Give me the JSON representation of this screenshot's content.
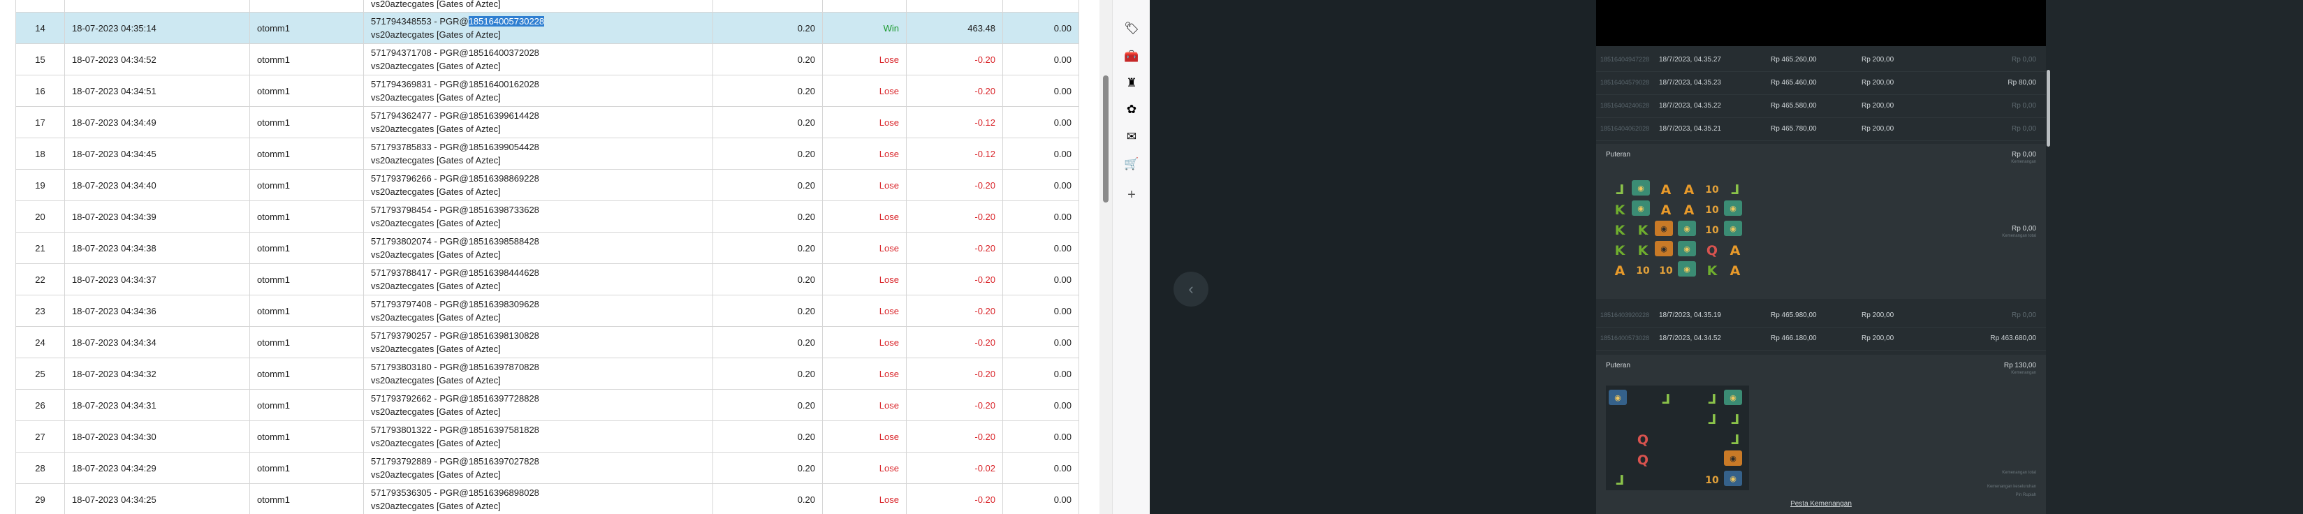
{
  "table": {
    "partial_row": {
      "desc": "vs20aztecgates [Gates of Aztec]"
    },
    "selected_highlight": "185164005730228",
    "rows": [
      {
        "no": "14",
        "date": "18-07-2023 04:35:14",
        "user": "otomm1",
        "desc_id": "571794348553 - PGR@",
        "desc_ref": "185164005730228",
        "desc_game": "vs20aztecgates [Gates of Aztec]",
        "bet": "0.20",
        "result": "Win",
        "winloss": "463.48",
        "extra": "0.00",
        "selected": true
      },
      {
        "no": "15",
        "date": "18-07-2023 04:34:52",
        "user": "otomm1",
        "desc_id": "571794371708 - PGR@",
        "desc_ref": "18516400372028",
        "desc_game": "vs20aztecgates [Gates of Aztec]",
        "bet": "0.20",
        "result": "Lose",
        "winloss": "-0.20",
        "extra": "0.00"
      },
      {
        "no": "16",
        "date": "18-07-2023 04:34:51",
        "user": "otomm1",
        "desc_id": "571794369831 - PGR@",
        "desc_ref": "18516400162028",
        "desc_game": "vs20aztecgates [Gates of Aztec]",
        "bet": "0.20",
        "result": "Lose",
        "winloss": "-0.20",
        "extra": "0.00"
      },
      {
        "no": "17",
        "date": "18-07-2023 04:34:49",
        "user": "otomm1",
        "desc_id": "571794362477 - PGR@",
        "desc_ref": "18516399614428",
        "desc_game": "vs20aztecgates [Gates of Aztec]",
        "bet": "0.20",
        "result": "Lose",
        "winloss": "-0.12",
        "extra": "0.00"
      },
      {
        "no": "18",
        "date": "18-07-2023 04:34:45",
        "user": "otomm1",
        "desc_id": "571793785833 - PGR@",
        "desc_ref": "18516399054428",
        "desc_game": "vs20aztecgates [Gates of Aztec]",
        "bet": "0.20",
        "result": "Lose",
        "winloss": "-0.12",
        "extra": "0.00"
      },
      {
        "no": "19",
        "date": "18-07-2023 04:34:40",
        "user": "otomm1",
        "desc_id": "571793796266 - PGR@",
        "desc_ref": "18516398869228",
        "desc_game": "vs20aztecgates [Gates of Aztec]",
        "bet": "0.20",
        "result": "Lose",
        "winloss": "-0.20",
        "extra": "0.00"
      },
      {
        "no": "20",
        "date": "18-07-2023 04:34:39",
        "user": "otomm1",
        "desc_id": "571793798454 - PGR@",
        "desc_ref": "18516398733628",
        "desc_game": "vs20aztecgates [Gates of Aztec]",
        "bet": "0.20",
        "result": "Lose",
        "winloss": "-0.20",
        "extra": "0.00"
      },
      {
        "no": "21",
        "date": "18-07-2023 04:34:38",
        "user": "otomm1",
        "desc_id": "571793802074 - PGR@",
        "desc_ref": "18516398588428",
        "desc_game": "vs20aztecgates [Gates of Aztec]",
        "bet": "0.20",
        "result": "Lose",
        "winloss": "-0.20",
        "extra": "0.00"
      },
      {
        "no": "22",
        "date": "18-07-2023 04:34:37",
        "user": "otomm1",
        "desc_id": "571793788417 - PGR@",
        "desc_ref": "18516398444628",
        "desc_game": "vs20aztecgates [Gates of Aztec]",
        "bet": "0.20",
        "result": "Lose",
        "winloss": "-0.20",
        "extra": "0.00"
      },
      {
        "no": "23",
        "date": "18-07-2023 04:34:36",
        "user": "otomm1",
        "desc_id": "571793797408 - PGR@",
        "desc_ref": "18516398309628",
        "desc_game": "vs20aztecgates [Gates of Aztec]",
        "bet": "0.20",
        "result": "Lose",
        "winloss": "-0.20",
        "extra": "0.00"
      },
      {
        "no": "24",
        "date": "18-07-2023 04:34:34",
        "user": "otomm1",
        "desc_id": "571793790257 - PGR@",
        "desc_ref": "18516398130828",
        "desc_game": "vs20aztecgates [Gates of Aztec]",
        "bet": "0.20",
        "result": "Lose",
        "winloss": "-0.20",
        "extra": "0.00"
      },
      {
        "no": "25",
        "date": "18-07-2023 04:34:32",
        "user": "otomm1",
        "desc_id": "571793803180 - PGR@",
        "desc_ref": "18516397870828",
        "desc_game": "vs20aztecgates [Gates of Aztec]",
        "bet": "0.20",
        "result": "Lose",
        "winloss": "-0.20",
        "extra": "0.00"
      },
      {
        "no": "26",
        "date": "18-07-2023 04:34:31",
        "user": "otomm1",
        "desc_id": "571793792662 - PGR@",
        "desc_ref": "18516397728828",
        "desc_game": "vs20aztecgates [Gates of Aztec]",
        "bet": "0.20",
        "result": "Lose",
        "winloss": "-0.20",
        "extra": "0.00"
      },
      {
        "no": "27",
        "date": "18-07-2023 04:34:30",
        "user": "otomm1",
        "desc_id": "571793801322 - PGR@",
        "desc_ref": "18516397581828",
        "desc_game": "vs20aztecgates [Gates of Aztec]",
        "bet": "0.20",
        "result": "Lose",
        "winloss": "-0.20",
        "extra": "0.00"
      },
      {
        "no": "28",
        "date": "18-07-2023 04:34:29",
        "user": "otomm1",
        "desc_id": "571793792889 - PGR@",
        "desc_ref": "18516397027828",
        "desc_game": "vs20aztecgates [Gates of Aztec]",
        "bet": "0.20",
        "result": "Lose",
        "winloss": "-0.02",
        "extra": "0.00"
      },
      {
        "no": "29",
        "date": "18-07-2023 04:34:25",
        "user": "otomm1",
        "desc_id": "571793536305 - PGR@",
        "desc_ref": "18516396898028",
        "desc_game": "vs20aztecgates [Gates of Aztec]",
        "bet": "0.20",
        "result": "Lose",
        "winloss": "-0.20",
        "extra": "0.00"
      }
    ]
  },
  "side_icons": [
    {
      "name": "tag-icon",
      "glyph": "🏷"
    },
    {
      "name": "gift-icon",
      "glyph": "🧰"
    },
    {
      "name": "chess-icon",
      "glyph": "♜"
    },
    {
      "name": "copilot-icon",
      "glyph": "✿"
    },
    {
      "name": "outlook-icon",
      "glyph": "✉"
    },
    {
      "name": "shopping-icon",
      "glyph": "🛒"
    },
    {
      "name": "add-icon",
      "glyph": "+"
    }
  ],
  "game_history": {
    "rows_top": [
      {
        "id": "18516404947228",
        "date": "18/7/2023, 04.35.27",
        "balance": "Rp 465.260,00",
        "bet": "Rp 200,00",
        "win": "Rp 0,00",
        "win_positive": false
      },
      {
        "id": "18516404579028",
        "date": "18/7/2023, 04.35.23",
        "balance": "Rp 465.460,00",
        "bet": "Rp 200,00",
        "win": "Rp 80,00",
        "win_positive": true
      },
      {
        "id": "18516404240628",
        "date": "18/7/2023, 04.35.22",
        "balance": "Rp 465.580,00",
        "bet": "Rp 200,00",
        "win": "Rp 0,00",
        "win_positive": false
      },
      {
        "id": "18516404062028",
        "date": "18/7/2023, 04.35.21",
        "balance": "Rp 465.780,00",
        "bet": "Rp 200,00",
        "win": "Rp 0,00",
        "win_positive": false
      }
    ],
    "spin1": {
      "title": "Puteran",
      "amount": "Rp 0,00",
      "sub": "Kemenangan",
      "amount2": "Rp 0,00",
      "sub2": "Kemenangan total"
    },
    "grid1": [
      [
        "J",
        "face",
        "A",
        "A",
        "T",
        "J"
      ],
      [
        "K",
        "face",
        "A",
        "A",
        "T",
        "face"
      ],
      [
        "K",
        "K",
        "face-o",
        "face",
        "T",
        "face"
      ],
      [
        "K",
        "K",
        "face-o",
        "face",
        "Q",
        "A"
      ],
      [
        "A",
        "T",
        "T",
        "face",
        "K",
        "A"
      ]
    ],
    "rows_mid": [
      {
        "id": "18516403920228",
        "date": "18/7/2023, 04.35.19",
        "balance": "Rp 465.980,00",
        "bet": "Rp 200,00",
        "win": "Rp 0,00",
        "win_positive": false
      },
      {
        "id": "18516400573028",
        "date": "18/7/2023, 04.34.52",
        "balance": "Rp 466.180,00",
        "bet": "Rp 200,00",
        "win": "Rp 463.680,00",
        "win_positive": true
      }
    ],
    "spin2": {
      "title": "Puteran",
      "amount": "Rp 130,00",
      "sub": "Kemenangan",
      "note1": "Kemenangan total",
      "note2": "Kemenangan keseluruhan",
      "note3": "Pin Rupiah"
    },
    "grid2": [
      [
        "face-b",
        "",
        "J",
        "",
        "J",
        "face"
      ],
      [
        "",
        "",
        "",
        "",
        "J",
        "J"
      ],
      [
        "",
        "Q",
        "",
        "",
        "",
        "J"
      ],
      [
        "",
        "Q",
        "",
        "",
        "",
        "face-o"
      ],
      [
        "J",
        "",
        "",
        "",
        "T",
        "face-b"
      ]
    ],
    "win_link": "Pesta Kemenangan"
  }
}
